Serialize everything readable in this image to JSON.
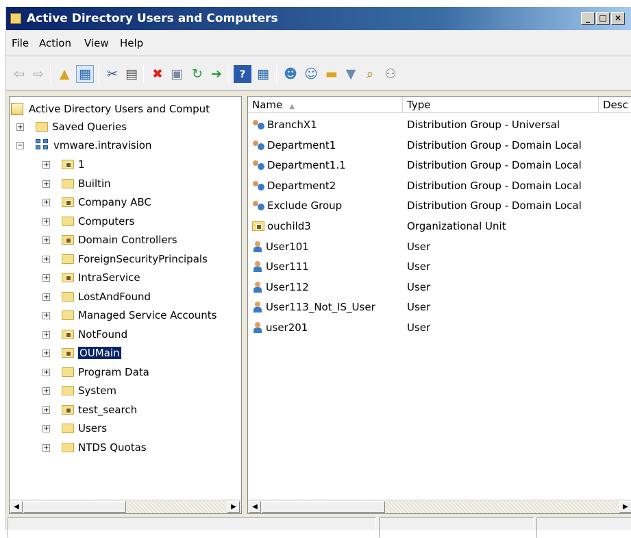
{
  "window": {
    "title": "Active Directory Users and Computers"
  },
  "menu": {
    "file": "File",
    "action": "Action",
    "view": "View",
    "help": "Help"
  },
  "toolbar": {
    "icons": [
      "back-icon",
      "forward-icon",
      "up-folder-icon",
      "show-tree-icon",
      "cut-icon",
      "paste-icon",
      "delete-icon",
      "properties-icon",
      "refresh-icon",
      "export-icon",
      "help-icon",
      "console-icon",
      "new-user-icon",
      "new-group-icon",
      "new-ou-icon",
      "filter-icon",
      "find-icon",
      "add-to-group-icon"
    ]
  },
  "tree": {
    "root": "Active Directory Users and Comput",
    "saved_queries": "Saved Queries",
    "domain": "vmware.intravision",
    "children": [
      {
        "label": "1",
        "ou": true
      },
      {
        "label": "Builtin",
        "ou": false
      },
      {
        "label": "Company ABC",
        "ou": true
      },
      {
        "label": "Computers",
        "ou": false
      },
      {
        "label": "Domain Controllers",
        "ou": true
      },
      {
        "label": "ForeignSecurityPrincipals",
        "ou": false
      },
      {
        "label": "IntraService",
        "ou": true
      },
      {
        "label": "LostAndFound",
        "ou": false
      },
      {
        "label": "Managed Service Accounts",
        "ou": false
      },
      {
        "label": "NotFound",
        "ou": true
      },
      {
        "label": "OUMain",
        "ou": true,
        "selected": true
      },
      {
        "label": "Program Data",
        "ou": false
      },
      {
        "label": "System",
        "ou": false
      },
      {
        "label": "test_search",
        "ou": true
      },
      {
        "label": "Users",
        "ou": false
      },
      {
        "label": "NTDS Quotas",
        "ou": false
      }
    ]
  },
  "list": {
    "columns": {
      "name": "Name",
      "type": "Type",
      "description": "Desc"
    },
    "rows": [
      {
        "name": "BranchX1",
        "type": "Distribution Group - Universal",
        "icon": "group"
      },
      {
        "name": "Department1",
        "type": "Distribution Group - Domain Local",
        "icon": "group"
      },
      {
        "name": "Department1.1",
        "type": "Distribution Group - Domain Local",
        "icon": "group"
      },
      {
        "name": "Department2",
        "type": "Distribution Group - Domain Local",
        "icon": "group"
      },
      {
        "name": "Exclude Group",
        "type": "Distribution Group - Domain Local",
        "icon": "group"
      },
      {
        "name": "ouchild3",
        "type": "Organizational Unit",
        "icon": "ou"
      },
      {
        "name": "User101",
        "type": "User",
        "icon": "user"
      },
      {
        "name": "User111",
        "type": "User",
        "icon": "user"
      },
      {
        "name": "User112",
        "type": "User",
        "icon": "user"
      },
      {
        "name": "User113_Not_IS_User",
        "type": "User",
        "icon": "user"
      },
      {
        "name": "user201",
        "type": "User",
        "icon": "user"
      }
    ]
  },
  "colors": {
    "selection": "#0a246a",
    "titlebar": "#0a246a"
  }
}
